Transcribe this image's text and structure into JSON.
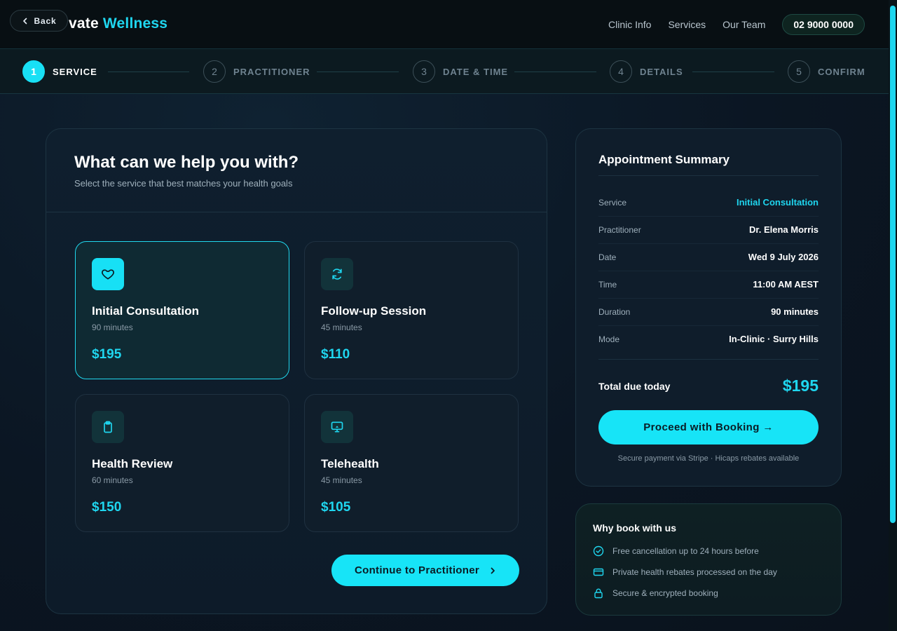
{
  "header": {
    "brand_visible": "vate",
    "brand_accent": "Wellness",
    "back_label": "Back",
    "nav": [
      "Clinic Info",
      "Services",
      "Our Team"
    ],
    "phone": "02 9000 0000"
  },
  "stepper": {
    "steps": [
      {
        "num": "1",
        "label": "SERVICE",
        "active": true
      },
      {
        "num": "2",
        "label": "PRACTITIONER",
        "active": false
      },
      {
        "num": "3",
        "label": "DATE & TIME",
        "active": false
      },
      {
        "num": "4",
        "label": "DETAILS",
        "active": false
      },
      {
        "num": "5",
        "label": "CONFIRM",
        "active": false
      }
    ]
  },
  "main": {
    "title": "What can we help you with?",
    "subtitle": "Select the service that best matches your health goals",
    "services": [
      {
        "name": "Initial Consultation",
        "duration": "90 minutes",
        "price": "$195",
        "icon": "heart-icon",
        "selected": true
      },
      {
        "name": "Follow-up Session",
        "duration": "45 minutes",
        "price": "$110",
        "icon": "refresh-icon",
        "selected": false
      },
      {
        "name": "Health Review",
        "duration": "60 minutes",
        "price": "$150",
        "icon": "clipboard-icon",
        "selected": false
      },
      {
        "name": "Telehealth",
        "duration": "45 minutes",
        "price": "$105",
        "icon": "monitor-icon",
        "selected": false
      }
    ],
    "continue_label": "Continue to Practitioner"
  },
  "summary": {
    "title": "Appointment Summary",
    "rows": [
      {
        "key": "Service",
        "value": "Initial Consultation",
        "accent": true
      },
      {
        "key": "Practitioner",
        "value": "Dr. Elena Morris",
        "accent": false
      },
      {
        "key": "Date",
        "value": "Wed 9 July 2026",
        "accent": false
      },
      {
        "key": "Time",
        "value": "11:00 AM AEST",
        "accent": false
      },
      {
        "key": "Duration",
        "value": "90 minutes",
        "accent": false
      },
      {
        "key": "Mode",
        "value": "In-Clinic · Surry Hills",
        "accent": false
      }
    ],
    "total_label": "Total due today",
    "total_value": "$195",
    "proceed_label": "Proceed with Booking →",
    "note": "Secure payment via Stripe · Hicaps rebates available"
  },
  "why": {
    "title": "Why book with us",
    "items": [
      {
        "text": "Free cancellation up to 24 hours before",
        "icon": "check-circle-icon"
      },
      {
        "text": "Private health rebates processed on the day",
        "icon": "card-icon"
      },
      {
        "text": "Secure & encrypted booking",
        "icon": "lock-icon"
      }
    ]
  },
  "colors": {
    "accent": "#17e4f7",
    "background": "#0b1623",
    "card": "#0f1d2b"
  }
}
